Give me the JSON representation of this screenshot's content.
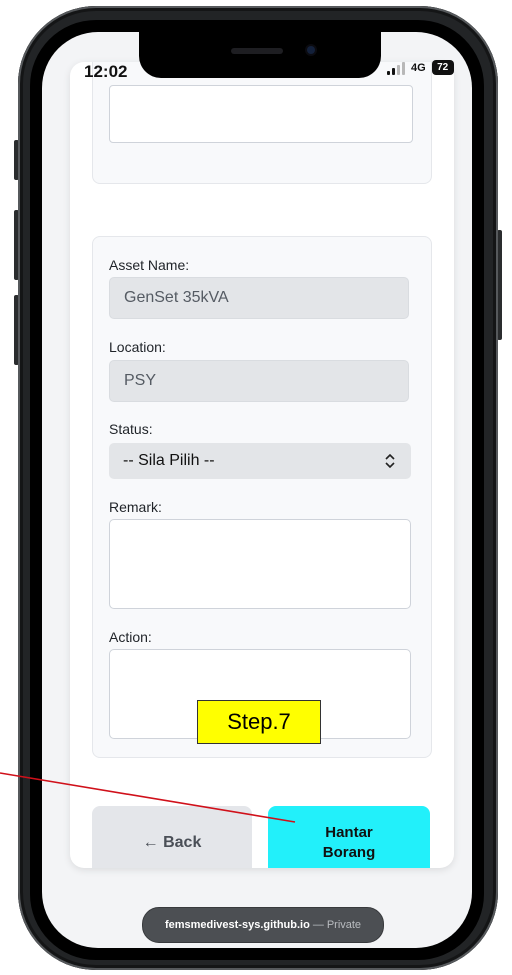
{
  "status_bar": {
    "time": "12:02",
    "network": "4G",
    "battery": "72"
  },
  "form": {
    "asset_name_label": "Asset Name:",
    "asset_name_value": "GenSet 35kVA",
    "location_label": "Location:",
    "location_value": "PSY",
    "status_label": "Status:",
    "status_selected": "-- Sila Pilih --",
    "remark_label": "Remark:",
    "remark_value": "",
    "action_label": "Action:",
    "action_value": ""
  },
  "buttons": {
    "back_label": "← Back",
    "submit_label": "Hantar\nBorang"
  },
  "browser": {
    "domain": "femsmedivest-sys.github.io",
    "separator": "—",
    "visibility": "Private"
  },
  "annotation": {
    "step_label": "Step.7",
    "color": "#ffff00",
    "arrow_color": "#d0101a"
  },
  "colors": {
    "submit_button": "#22f0fa",
    "back_button": "#e4e6ea"
  }
}
